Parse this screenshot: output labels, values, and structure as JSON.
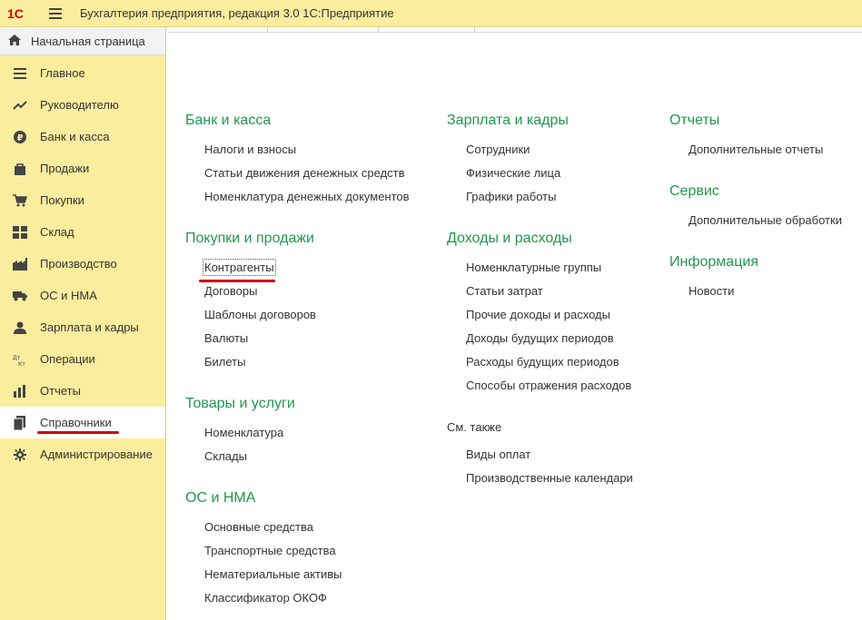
{
  "titlebar": {
    "logo": "1С",
    "title": "Бухгалтерия предприятия, редакция 3.0 1С:Предприятие"
  },
  "home": {
    "label": "Начальная страница",
    "icon": "home-icon"
  },
  "sidebar": {
    "items": [
      {
        "label": "Главное",
        "icon": "list-icon"
      },
      {
        "label": "Руководителю",
        "icon": "trend-icon"
      },
      {
        "label": "Банк и касса",
        "icon": "ruble-icon"
      },
      {
        "label": "Продажи",
        "icon": "bag-icon"
      },
      {
        "label": "Покупки",
        "icon": "cart-icon"
      },
      {
        "label": "Склад",
        "icon": "warehouse-icon"
      },
      {
        "label": "Производство",
        "icon": "factory-icon"
      },
      {
        "label": "ОС и НМА",
        "icon": "truck-icon"
      },
      {
        "label": "Зарплата и кадры",
        "icon": "person-icon"
      },
      {
        "label": "Операции",
        "icon": "dt-kt-icon"
      },
      {
        "label": "Отчеты",
        "icon": "bar-chart-icon"
      },
      {
        "label": "Справочники",
        "icon": "book-icon",
        "active": true
      },
      {
        "label": "Администрирование",
        "icon": "gear-icon"
      }
    ]
  },
  "content": {
    "col1": {
      "groups": [
        {
          "title": "Банк и касса",
          "links": [
            "Налоги и взносы",
            "Статьи движения денежных средств",
            "Номенклатура денежных документов"
          ]
        },
        {
          "title": "Покупки и продажи",
          "links": [
            "Контрагенты",
            "Договоры",
            "Шаблоны договоров",
            "Валюты",
            "Билеты"
          ]
        },
        {
          "title": "Товары и услуги",
          "links": [
            "Номенклатура",
            "Склады"
          ]
        },
        {
          "title": "ОС и НМА",
          "links": [
            "Основные средства",
            "Транспортные средства",
            "Нематериальные активы",
            "Классификатор ОКОФ"
          ]
        }
      ]
    },
    "col2": {
      "groups": [
        {
          "title": "Зарплата и кадры",
          "links": [
            "Сотрудники",
            "Физические лица",
            "Графики работы"
          ]
        },
        {
          "title": "Доходы и расходы",
          "links": [
            "Номенклатурные группы",
            "Статьи затрат",
            "Прочие доходы и расходы",
            "Доходы будущих периодов",
            "Расходы будущих периодов",
            "Способы отражения расходов"
          ]
        }
      ],
      "see_also": {
        "title": "См. также",
        "links": [
          "Виды оплат",
          "Производственные календари"
        ]
      }
    },
    "col3": {
      "groups": [
        {
          "title": "Отчеты",
          "links": [
            "Дополнительные отчеты"
          ]
        },
        {
          "title": "Сервис",
          "links": [
            "Дополнительные обработки"
          ]
        },
        {
          "title": "Информация",
          "links": [
            "Новости"
          ]
        }
      ]
    }
  },
  "colors": {
    "sidebar_bg": "#fbed9e",
    "group_title": "#21974f",
    "highlight_underline": "#d40000",
    "logo_red": "#d40000"
  }
}
